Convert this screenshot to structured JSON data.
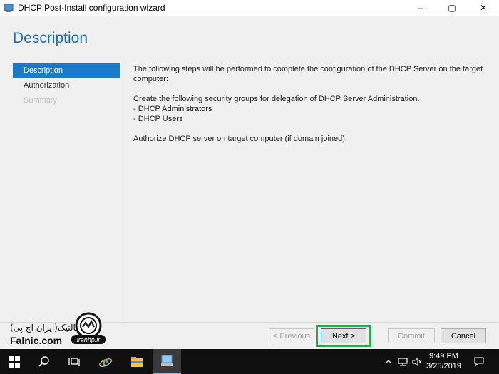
{
  "window": {
    "title": "DHCP Post-Install configuration wizard",
    "controls": {
      "minimize": "–",
      "maximize": "▢",
      "close": "✕"
    }
  },
  "page": {
    "title": "Description"
  },
  "nav": {
    "items": [
      {
        "label": "Description",
        "state": "active"
      },
      {
        "label": "Authorization",
        "state": "normal"
      },
      {
        "label": "Summary",
        "state": "disabled"
      }
    ]
  },
  "content": {
    "intro": "The following steps will be performed to complete the configuration of the DHCP Server on the target computer:",
    "groups_intro": "Create the following security groups for delegation of DHCP Server Administration.",
    "groups": [
      "- DHCP Administrators",
      "- DHCP Users"
    ],
    "authorize": "Authorize DHCP server on target computer (if domain joined)."
  },
  "buttons": {
    "previous": "< Previous",
    "next": "Next >",
    "commit": "Commit",
    "cancel": "Cancel"
  },
  "watermark": {
    "fa_text": "فالنیک(ایران اچ پی)",
    "en_text": "Falnic.com",
    "logo_text": "iranhp.ir"
  },
  "taskbar": {
    "icons": [
      "windows-start-icon",
      "search-icon",
      "task-view-icon",
      "internet-explorer-icon",
      "file-explorer-icon",
      "server-wizard-icon"
    ],
    "tray_icons": [
      "chevron-up-icon",
      "network-icon",
      "volume-icon",
      "notification-icon"
    ],
    "time": "9:49 PM",
    "date": "3/25/2019"
  },
  "colors": {
    "accent": "#1979ca",
    "title_blue": "#1f6fb5",
    "highlight_green": "#2ea44f",
    "taskbar": "#101010"
  }
}
